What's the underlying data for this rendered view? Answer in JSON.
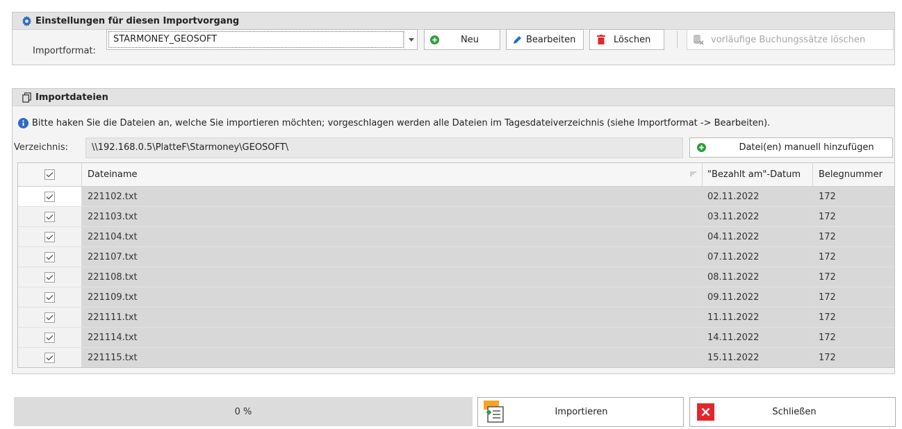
{
  "settings": {
    "title": "Einstellungen für diesen Importvorgang",
    "import_format_label": "Importformat:",
    "import_format_value": "STARMONEY_GEOSOFT",
    "buttons": {
      "new": "Neu",
      "edit": "Bearbeiten",
      "delete": "Löschen",
      "delete_preliminary": "vorläufige Buchungssätze löschen"
    }
  },
  "import_files": {
    "title": "Importdateien",
    "info": "Bitte haken Sie die Dateien an, welche Sie importieren möchten; vorgeschlagen werden alle Dateien im Tagesdateiverzeichnis (siehe Importformat -> Bearbeiten).",
    "directory_label": "Verzeichnis:",
    "directory_value": "\\\\192.168.0.5\\PlatteF\\Starmoney\\GEOSOFT\\",
    "add_manual_button": "Datei(en) manuell hinzufügen",
    "columns": {
      "filename": "Dateiname",
      "paid_date": "\"Bezahlt am\"-Datum",
      "doc_number": "Belegnummer"
    },
    "rows": [
      {
        "checked": true,
        "filename": "221102.txt",
        "paid_date": "02.11.2022",
        "doc_number": "172"
      },
      {
        "checked": true,
        "filename": "221103.txt",
        "paid_date": "03.11.2022",
        "doc_number": "172"
      },
      {
        "checked": true,
        "filename": "221104.txt",
        "paid_date": "04.11.2022",
        "doc_number": "172"
      },
      {
        "checked": true,
        "filename": "221107.txt",
        "paid_date": "07.11.2022",
        "doc_number": "172"
      },
      {
        "checked": true,
        "filename": "221108.txt",
        "paid_date": "08.11.2022",
        "doc_number": "172"
      },
      {
        "checked": true,
        "filename": "221109.txt",
        "paid_date": "09.11.2022",
        "doc_number": "172"
      },
      {
        "checked": true,
        "filename": "221111.txt",
        "paid_date": "11.11.2022",
        "doc_number": "172"
      },
      {
        "checked": true,
        "filename": "221114.txt",
        "paid_date": "14.11.2022",
        "doc_number": "172"
      },
      {
        "checked": true,
        "filename": "221115.txt",
        "paid_date": "15.11.2022",
        "doc_number": "172"
      }
    ]
  },
  "footer": {
    "progress_text": "0 %",
    "progress_fraction": 0,
    "import_button": "Importieren",
    "close_button": "Schließen"
  },
  "icons": {
    "settings": "gear-icon",
    "files": "copy-icon",
    "info": "info-icon",
    "new": "plus-circle-icon",
    "edit": "pencil-icon",
    "delete": "trash-icon",
    "delete_preliminary": "database-delete-icon",
    "import": "import-list-icon",
    "close": "close-icon"
  },
  "colors": {
    "accent_blue": "#2b6cc4",
    "green": "#2e9e3e",
    "red": "#e3262b",
    "grid_row": "#d8d8d8"
  }
}
